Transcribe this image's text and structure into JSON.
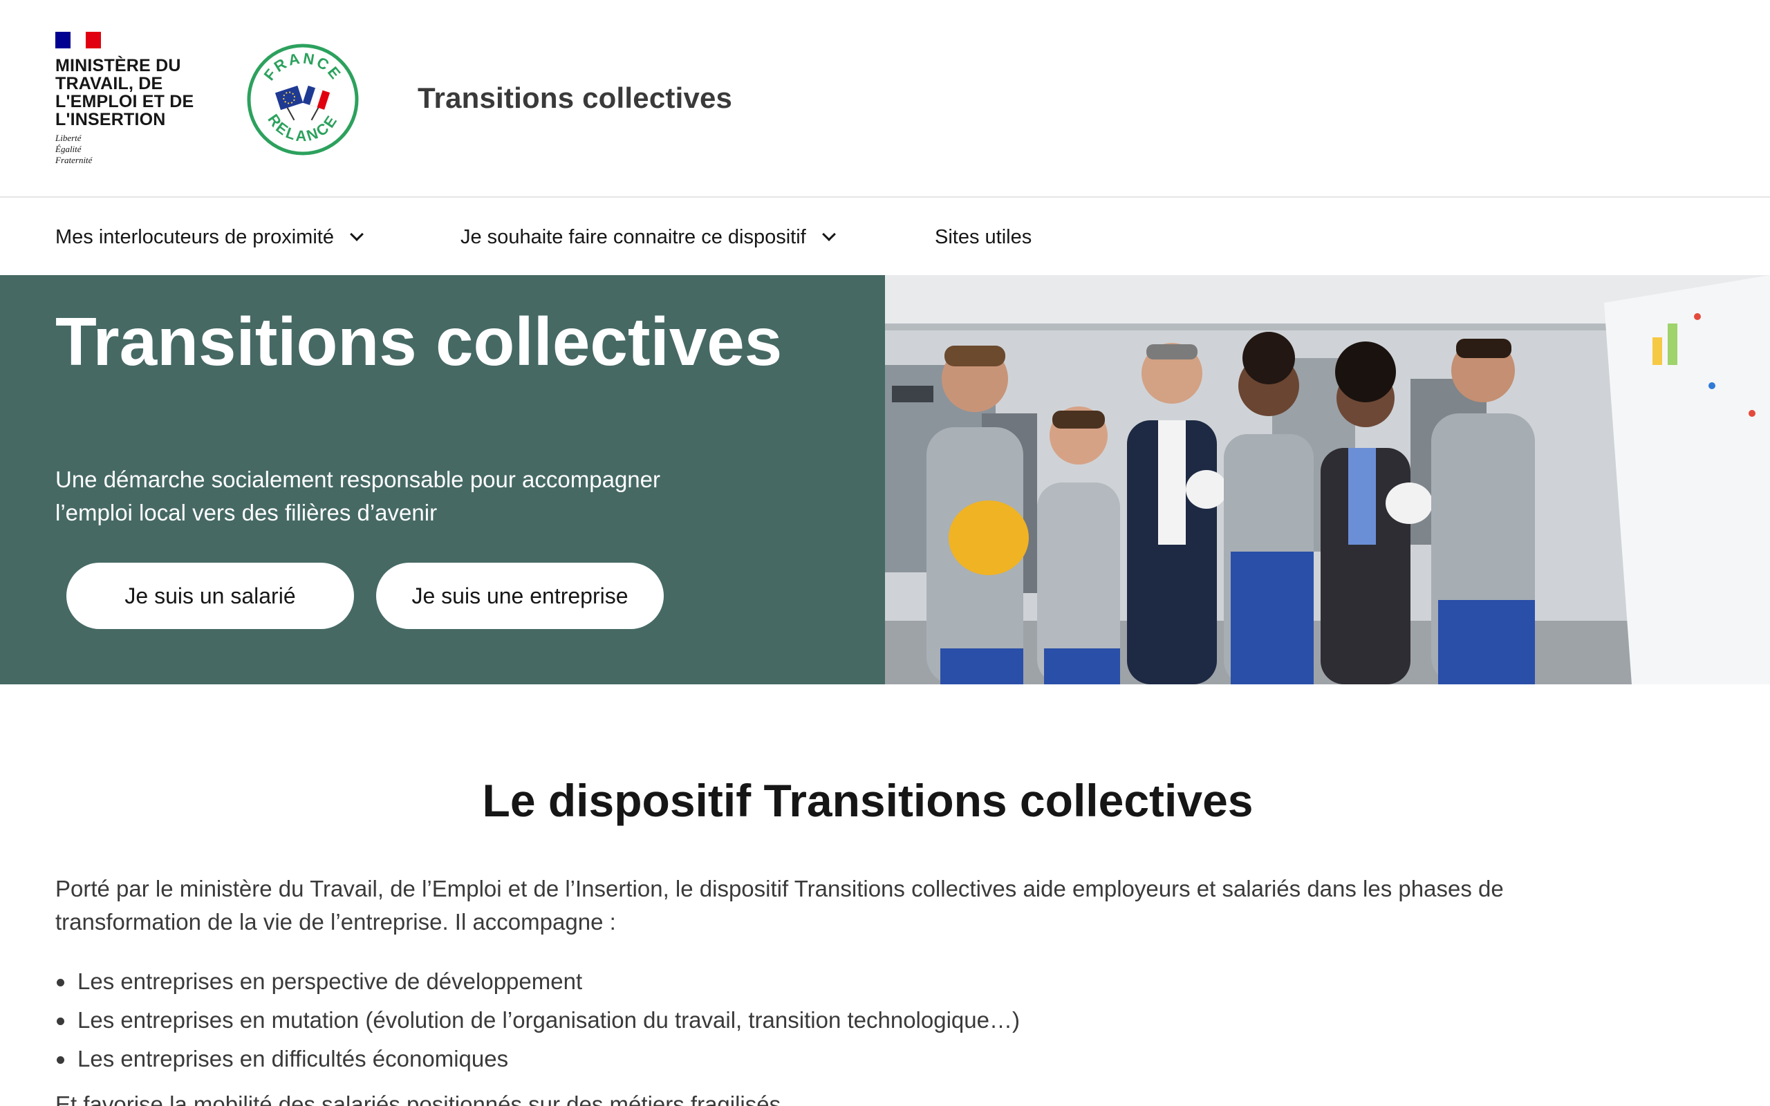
{
  "header": {
    "ministry_name": "MINISTÈRE DU TRAVAIL, DE L'EMPLOI ET DE L'INSERTION",
    "motto_line1": "Liberté",
    "motto_line2": "Égalité",
    "motto_line3": "Fraternité",
    "relance_logo_top": "FRANCE",
    "relance_logo_bottom": "RELANCE",
    "site_title": "Transitions collectives"
  },
  "nav": {
    "items": [
      {
        "label": "Mes interlocuteurs de proximité",
        "icon": "chevron-down-icon"
      },
      {
        "label": "Je souhaite faire connaitre ce dispositif",
        "icon": "chevron-down-icon"
      },
      {
        "label": "Sites utiles"
      }
    ]
  },
  "hero": {
    "title": "Transitions collectives",
    "subtitle": "Une démarche socialement responsable pour accompagner l’emploi local vers des filières d’avenir",
    "buttons": [
      {
        "label": "Je suis un salarié"
      },
      {
        "label": "Je suis une entreprise"
      }
    ],
    "image_alt": "Group of factory workers with hard hats listening to a colleague at a whiteboard",
    "background_color": "#466964"
  },
  "content": {
    "section_title": "Le dispositif Transitions collectives",
    "intro": "Porté par le ministère du Travail, de l’Emploi et de l’Insertion, le dispositif Transitions collectives aide employeurs et salariés dans les phases de transformation de la vie de l’entreprise. Il accompagne :",
    "bullets": [
      "Les entreprises en perspective de développement",
      "Les entreprises en mutation (évolution de l’organisation du travail, transition technologique…)",
      "Les entreprises en difficultés économiques"
    ],
    "trailing_text": "Et favorise la mobilité des salariés positionnés sur des métiers fragilisés"
  },
  "colors": {
    "hero_green": "#466964",
    "relance_green": "#2ca15d",
    "gov_blue": "#000091",
    "gov_red": "#e1000f"
  }
}
